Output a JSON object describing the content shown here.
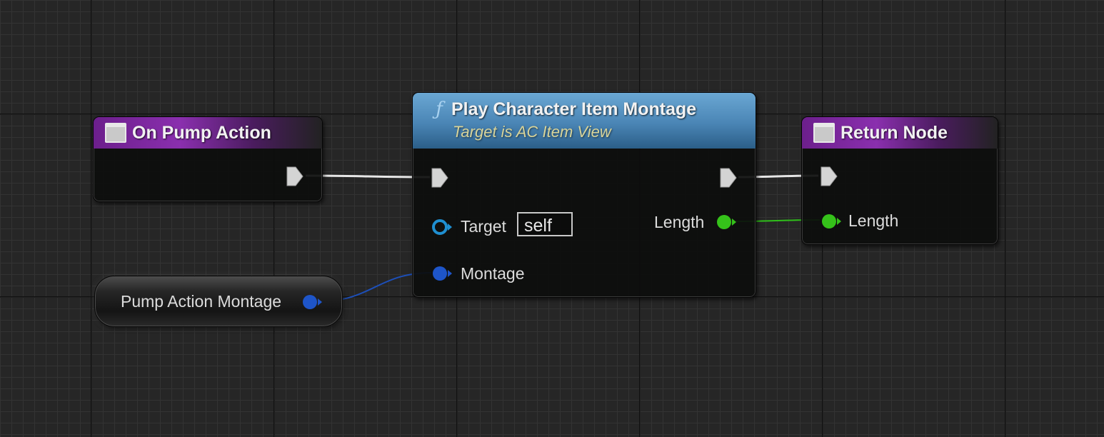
{
  "nodes": {
    "on_pump_action": {
      "title": "On Pump Action"
    },
    "play_montage": {
      "title": "Play Character Item Montage",
      "subtitle": "Target is AC Item View",
      "func_icon": "ƒ",
      "pins": {
        "target_label": "Target",
        "target_default": "self",
        "montage_label": "Montage",
        "length_label": "Length"
      }
    },
    "return_node": {
      "title": "Return Node",
      "pins": {
        "length_label": "Length"
      }
    },
    "pump_action_montage_var": {
      "label": "Pump Action Montage"
    }
  },
  "colors": {
    "exec_pin": "#d9d9d9",
    "object_pin": "#1f8fd1",
    "montage_pin": "#1e55c9",
    "float_pin": "#35c21a",
    "event_header": "#8a2fae",
    "function_header": "#5a96c8"
  },
  "icons": {
    "event": "event-node-icon",
    "function": "function-icon",
    "exec": "exec-pin-icon",
    "data": "data-pin-icon"
  }
}
